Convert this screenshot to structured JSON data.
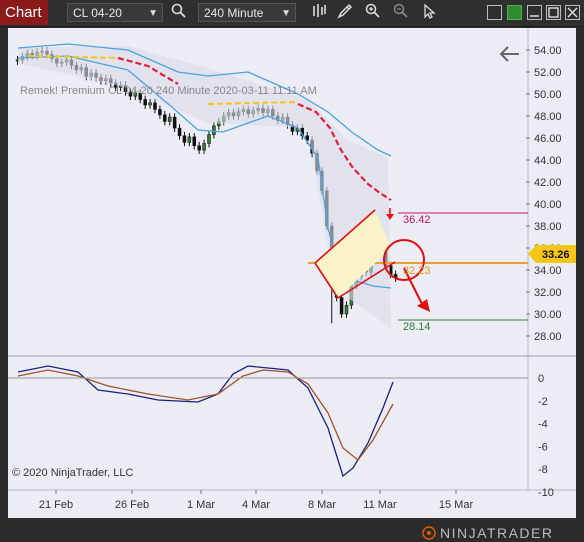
{
  "toolbar": {
    "chart_tab": "Chart",
    "instrument": "CL 04-20",
    "period": "240 Minute"
  },
  "chart": {
    "info_label": "Remek!  Premium  CL 04-20  240 Minute  2020-03-11 11:11 AM",
    "copyright": "© 2020 NinjaTrader, LLC",
    "brand": "NINJATRADER",
    "price_axis": [
      "54.00",
      "52.00",
      "50.00",
      "48.00",
      "46.00",
      "44.00",
      "42.00",
      "40.00",
      "38.00",
      "36.00",
      "34.00",
      "32.00",
      "30.00",
      "28.00"
    ],
    "osc_axis": [
      "0",
      "-2",
      "-4",
      "-6",
      "-8",
      "-10"
    ],
    "date_axis": [
      "21 Feb",
      "26 Feb",
      "1 Mar",
      "4 Mar",
      "8 Mar",
      "11 Mar",
      "15 Mar"
    ],
    "current_price": "33.26",
    "level_high": "36.42",
    "level_mid": "32.23",
    "level_low": "28.14",
    "colors": {
      "up": "#2e7d32",
      "down": "#111111",
      "band": "#4aa3df",
      "trail": "#e0203a",
      "current": "#f5c518",
      "red_level": "#c2185b",
      "green_level": "#2e7d32"
    }
  }
}
